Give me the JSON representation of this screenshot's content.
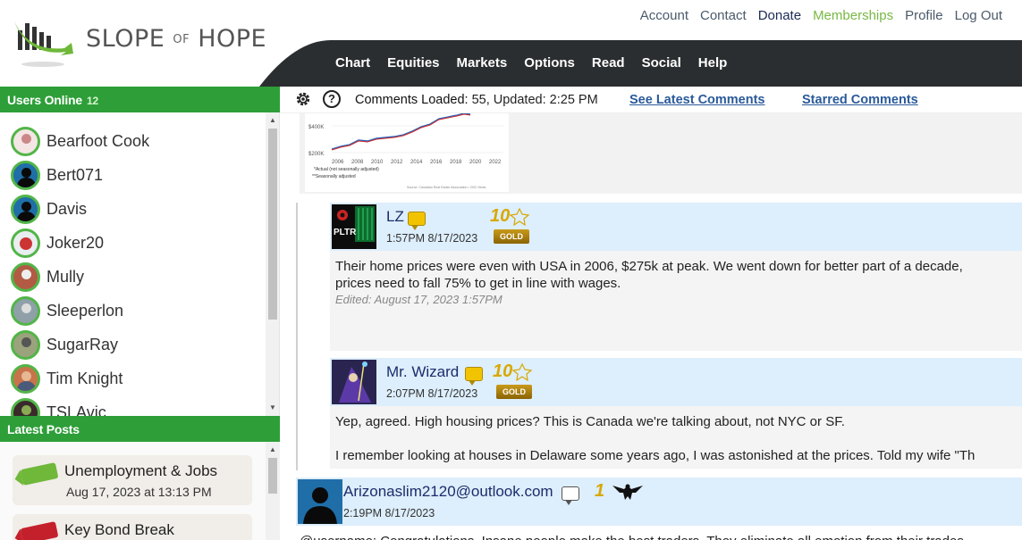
{
  "brand": {
    "logo_main": "SLOPE",
    "logo_of": "OF",
    "logo_end": "HOPE"
  },
  "topnav": {
    "account": "Account",
    "contact": "Contact",
    "donate": "Donate",
    "memberships": "Memberships",
    "profile": "Profile",
    "logout": "Log Out"
  },
  "mainnav": {
    "chart": "Chart",
    "equities": "Equities",
    "markets": "Markets",
    "options": "Options",
    "read": "Read",
    "social": "Social",
    "help": "Help"
  },
  "users_online": {
    "title": "Users Online",
    "count": "12",
    "users": [
      "Bearfoot Cook",
      "Bert071",
      "Davis",
      "Joker20",
      "Mully",
      "Sleeperlon",
      "SugarRay",
      "Tim Knight",
      "TSLAvic"
    ]
  },
  "latest_posts": {
    "title": "Latest Posts",
    "posts": [
      {
        "title": "Unemployment & Jobs",
        "date": "Aug 17, 2023 at 13:13 PM"
      },
      {
        "title": "Key Bond Break",
        "date": ""
      }
    ]
  },
  "toolbar": {
    "help_glyph": "?",
    "loaded_label": "Comments Loaded:",
    "loaded_value": "55, Updated:",
    "updated_time": "2:25 PM",
    "latest_link": "See Latest Comments",
    "starred_link": "Starred Comments"
  },
  "chart_thumb": {
    "y_labels": [
      "$400K",
      "$200K"
    ],
    "x_labels": [
      "2006",
      "2008",
      "2010",
      "2012",
      "2014",
      "2016",
      "2018",
      "2020",
      "2022"
    ],
    "legend1": "*Actual (not seasonally adjusted)",
    "legend2": "**Seasonally adjusted",
    "source": "Source: Canadian Real Estate Association • CBC News"
  },
  "comments": [
    {
      "user": "LZ",
      "time": "1:57PM 8/17/2023",
      "rank": "10",
      "badge": "GOLD",
      "avatar_text": "PLTR",
      "lines": [
        "Their home prices were even with USA in 2006, $275k at peak. We went down for better part of a decade,",
        "prices need to fall 75% to get in line with wages."
      ],
      "edited": "Edited: August 17, 2023 1:57PM"
    },
    {
      "user": "Mr. Wizard",
      "time": "2:07PM 8/17/2023",
      "rank": "10",
      "badge": "GOLD",
      "lines": [
        "Yep, agreed. High housing prices? This is Canada we're talking about, not NYC or SF.",
        "I remember looking at houses in Delaware some years ago, I was astonished at the prices. Told my wife \"Th"
      ]
    },
    {
      "user": "Arizonaslim2120@outlook.com",
      "time": "2:19PM 8/17/2023",
      "rank": "1",
      "lines": [
        "@username: Congratulations. Insane people make the best traders. They eliminate all emotion from their trades"
      ]
    }
  ],
  "colors": {
    "green": "#2d9e38",
    "nav_dark": "#2b2e30",
    "link_blue": "#2a5a9a",
    "comment_header": "#ddeefc",
    "memberships": "#78b843"
  }
}
